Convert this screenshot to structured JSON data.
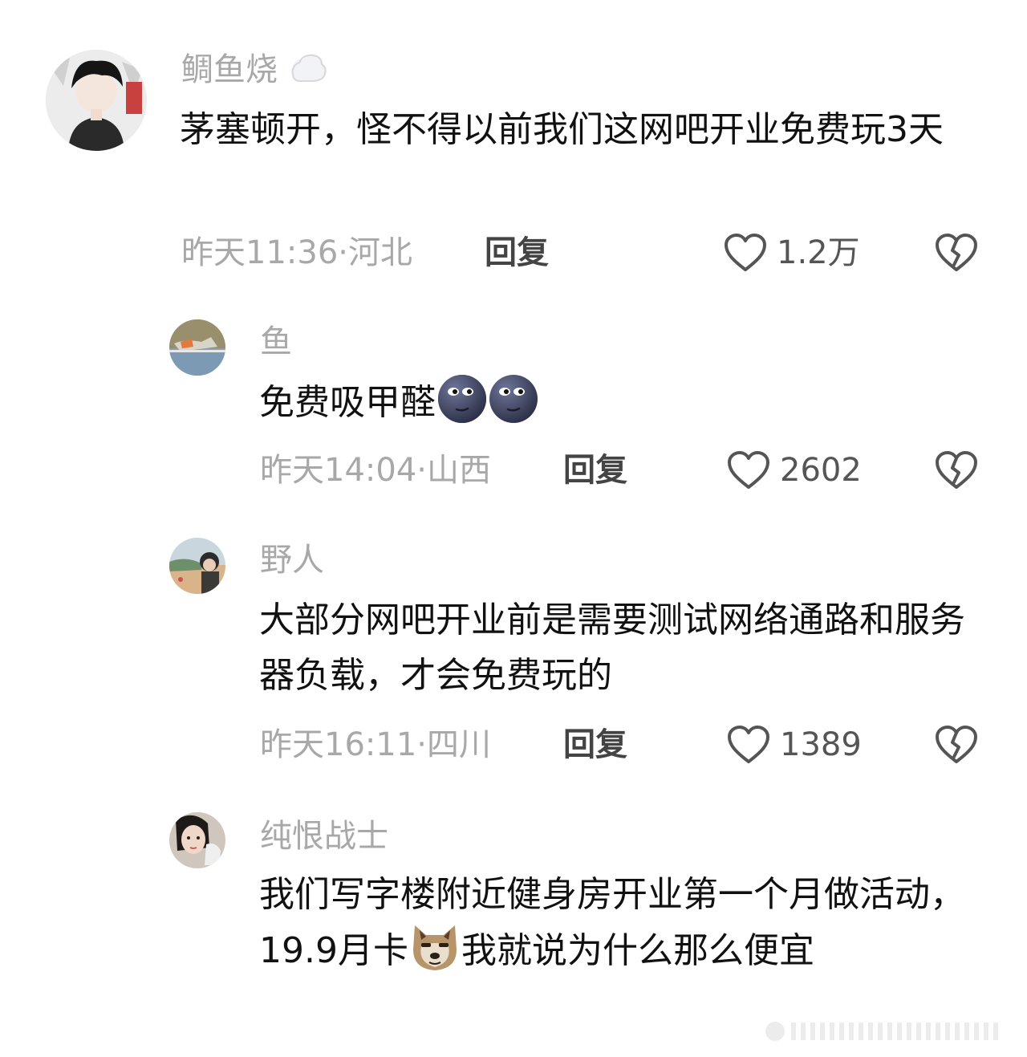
{
  "comments": [
    {
      "username": "鲷鱼烧",
      "username_emoji": "cloud-emoji",
      "text": "茅塞顿开，怪不得以前我们这网吧开业免费玩3天",
      "time_location": "昨天11:36·河北",
      "reply_label": "回复",
      "likes": "1.2万"
    },
    {
      "username": "鱼",
      "text": "免费吸甲醛",
      "text_emojis": [
        "new-moon-face-emoji",
        "new-moon-face-emoji"
      ],
      "time_location": "昨天14:04·山西",
      "reply_label": "回复",
      "likes": "2602"
    },
    {
      "username": "野人",
      "text": "大部分网吧开业前是需要测试网络通路和服务器负载，才会免费玩的",
      "time_location": "昨天16:11·四川",
      "reply_label": "回复",
      "likes": "1389"
    },
    {
      "username": "纯恨战士",
      "text_before_emoji": "我们写字楼附近健身房开业第一个月做活动，19.9月卡",
      "text_emoji": "doge-emoji",
      "text_after_emoji": "我就说为什么那么便宜",
      "time_location": "",
      "reply_label": "",
      "likes": ""
    }
  ],
  "icons": {
    "like": "heart-outline-icon",
    "dislike": "broken-heart-icon"
  },
  "colors": {
    "meta_gray": "#a8a8a8",
    "text": "#111111",
    "reply": "#444444",
    "icon": "#555555"
  }
}
